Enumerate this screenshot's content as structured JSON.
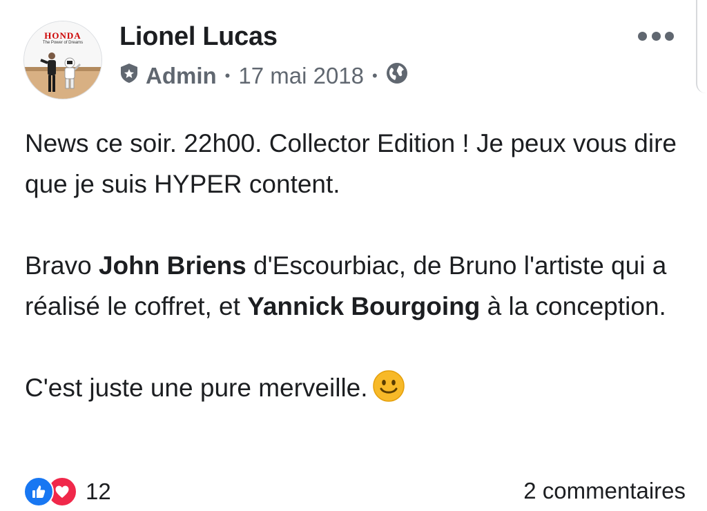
{
  "post": {
    "author": "Lionel Lucas",
    "avatar_logo": "HONDA",
    "avatar_tagline": "The Power of Dreams",
    "role": "Admin",
    "date": "17 mai 2018",
    "separator": "•",
    "audience_icon": "globe-icon",
    "role_icon": "admin-badge-icon",
    "menu_icon": "more-options-icon",
    "paragraphs": {
      "p1": "News ce soir. 22h00. Collector Edition ! Je peux vous dire que je suis HYPER content.",
      "p2": {
        "t1": "Bravo ",
        "b1": "John Briens",
        "t2": " d'Escourbiac, de Bruno l'artiste qui a réalisé le coffret, et ",
        "b2": "Yannick Bourgoing",
        "t3": " à la conception."
      },
      "p3": "C'est juste une pure merveille.",
      "emoji": "slightly-smiling-face-icon"
    }
  },
  "reactions": {
    "icons": [
      "like-icon",
      "love-icon"
    ],
    "count": "12",
    "comments": "2 commentaires"
  },
  "colors": {
    "text": "#1c1e21",
    "meta": "#606770",
    "like": "#1877f2",
    "love": "#f0284a",
    "emoji": "#f7b928"
  }
}
